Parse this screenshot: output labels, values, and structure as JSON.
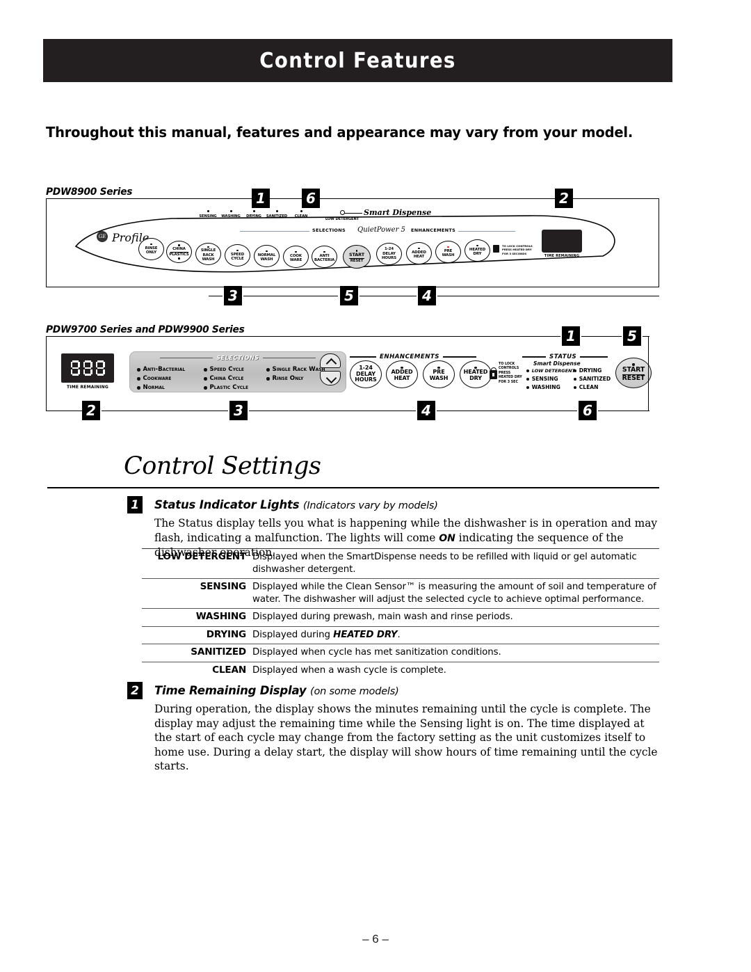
{
  "header": {
    "title": "Control Features"
  },
  "intro": "Throughout this manual, features and appearance may vary from your model.",
  "panel1": {
    "series_label": "PDW8900 Series",
    "brand": "GE",
    "brand_script": "Profile",
    "quietpower": "QuietPower 5",
    "smart_dispense": "Smart Dispense",
    "selections_label": "SELECTIONS",
    "enhancements_label": "ENHANCEMENTS",
    "status_lights": [
      "SENSING",
      "WASHING",
      "DRYING",
      "SANITIZED",
      "CLEAN",
      "LOW DETERGENT"
    ],
    "cycle_buttons": [
      {
        "lines": [
          "RINSE",
          "ONLY"
        ]
      },
      {
        "lines": [
          "CHINA",
          "PLASTICS"
        ],
        "split": true
      },
      {
        "lines": [
          "SINGLE",
          "RACK",
          "WASH"
        ]
      },
      {
        "lines": [
          "SPEED",
          "CYCLE"
        ]
      },
      {
        "lines": [
          "NORMAL",
          "WASH"
        ]
      },
      {
        "lines": [
          "COOK",
          "WARE"
        ]
      },
      {
        "lines": [
          "ANTI",
          "BACTERIA"
        ]
      }
    ],
    "start_button": {
      "lines": [
        "START",
        "RESET"
      ]
    },
    "enhancement_buttons": [
      {
        "lines": [
          "1-24",
          "DELAY",
          "HOURS"
        ]
      },
      {
        "lines": [
          "ADDED",
          "HEAT"
        ]
      },
      {
        "lines": [
          "PRE",
          "WASH"
        ],
        "red": true
      },
      {
        "lines": [
          "HEATED",
          "DRY"
        ]
      }
    ],
    "lock_note": [
      "TO LOCK CONTROLS",
      "PRESS HEATED DRY",
      "FOR 3 SECONDS"
    ],
    "time_remaining_label": "TIME REMAINING",
    "callouts_top": [
      "1",
      "6",
      "2"
    ],
    "callouts_bottom": [
      "3",
      "5",
      "4"
    ]
  },
  "panel2": {
    "series_label": "PDW9700 Series and PDW9900 Series",
    "time_remaining_label": "TIME REMAINING",
    "selections_label": "SELECTIONS",
    "enhancements_label": "ENHANCEMENTS",
    "status_label": "STATUS",
    "selections_col1": [
      "Anti-Bacterial",
      "Cookware",
      "Normal"
    ],
    "selections_col2": [
      "Speed Cycle",
      "China Cycle",
      "Plastic Cycle"
    ],
    "selections_col3": [
      "Single Rack Wash",
      "Rinse Only"
    ],
    "enhancement_buttons": [
      {
        "lines": [
          "1-24",
          "DELAY",
          "HOURS"
        ],
        "dot": false
      },
      {
        "lines": [
          "ADDED",
          "HEAT"
        ],
        "dot": true
      },
      {
        "lines": [
          "PRE",
          "WASH"
        ],
        "dot": true
      },
      {
        "lines": [
          "HEATED",
          "DRY"
        ],
        "dot": true
      }
    ],
    "lock_note": [
      "TO LOCK",
      "CONTROLS",
      "PRESS",
      "HEATED DRY",
      "FOR 3 SEC"
    ],
    "smart_dispense": "Smart Dispense",
    "status_col1": [
      "LOW DETERGENT",
      "SENSING",
      "WASHING"
    ],
    "status_col2": [
      "DRYING",
      "SANITIZED",
      "CLEAN"
    ],
    "start_button": {
      "lines": [
        "START",
        "RESET"
      ]
    },
    "callouts_top": [
      "1",
      "5"
    ],
    "callouts_bottom": [
      "2",
      "3",
      "4",
      "6"
    ]
  },
  "control_settings": {
    "heading": "Control Settings",
    "section1": {
      "num": "1",
      "title": "Status Indicator Lights",
      "subtitle": "(Indicators vary by models)",
      "body_part1": "The Status display tells you what is happening while the dishwasher is in operation and may flash, indicating a malfunction. The lights will come ",
      "body_emph": "ON",
      "body_part2": " indicating the sequence of the dishwasher operation.",
      "rows": [
        {
          "key": "LOW DETERGENT",
          "value": "Displayed when the SmartDispense needs to be refilled with liquid or gel automatic dishwasher detergent."
        },
        {
          "key": "SENSING",
          "value": "Displayed while the Clean Sensor™ is measuring the amount of soil and temperature of water. The dishwasher will adjust the selected cycle to achieve optimal performance."
        },
        {
          "key": "WASHING",
          "value": "Displayed during prewash, main wash and rinse periods."
        },
        {
          "key": "DRYING",
          "value_pre": "Displayed during ",
          "value_emph": "HEATED DRY",
          "value_post": "."
        },
        {
          "key": "SANITIZED",
          "value": "Displayed when cycle has met sanitization conditions."
        },
        {
          "key": "CLEAN",
          "value": "Displayed when a wash cycle is complete."
        }
      ]
    },
    "section2": {
      "num": "2",
      "title": "Time Remaining Display",
      "subtitle": "(on some models)",
      "body": "During operation, the display shows the minutes remaining until the cycle is complete. The display may adjust the remaining time while the Sensing light is on. The time displayed at the start of each cycle may change from the factory setting as the unit customizes itself to home use. During a delay start, the display will show hours of time remaining until the cycle starts."
    }
  },
  "footer": {
    "page": "– 6 –"
  }
}
